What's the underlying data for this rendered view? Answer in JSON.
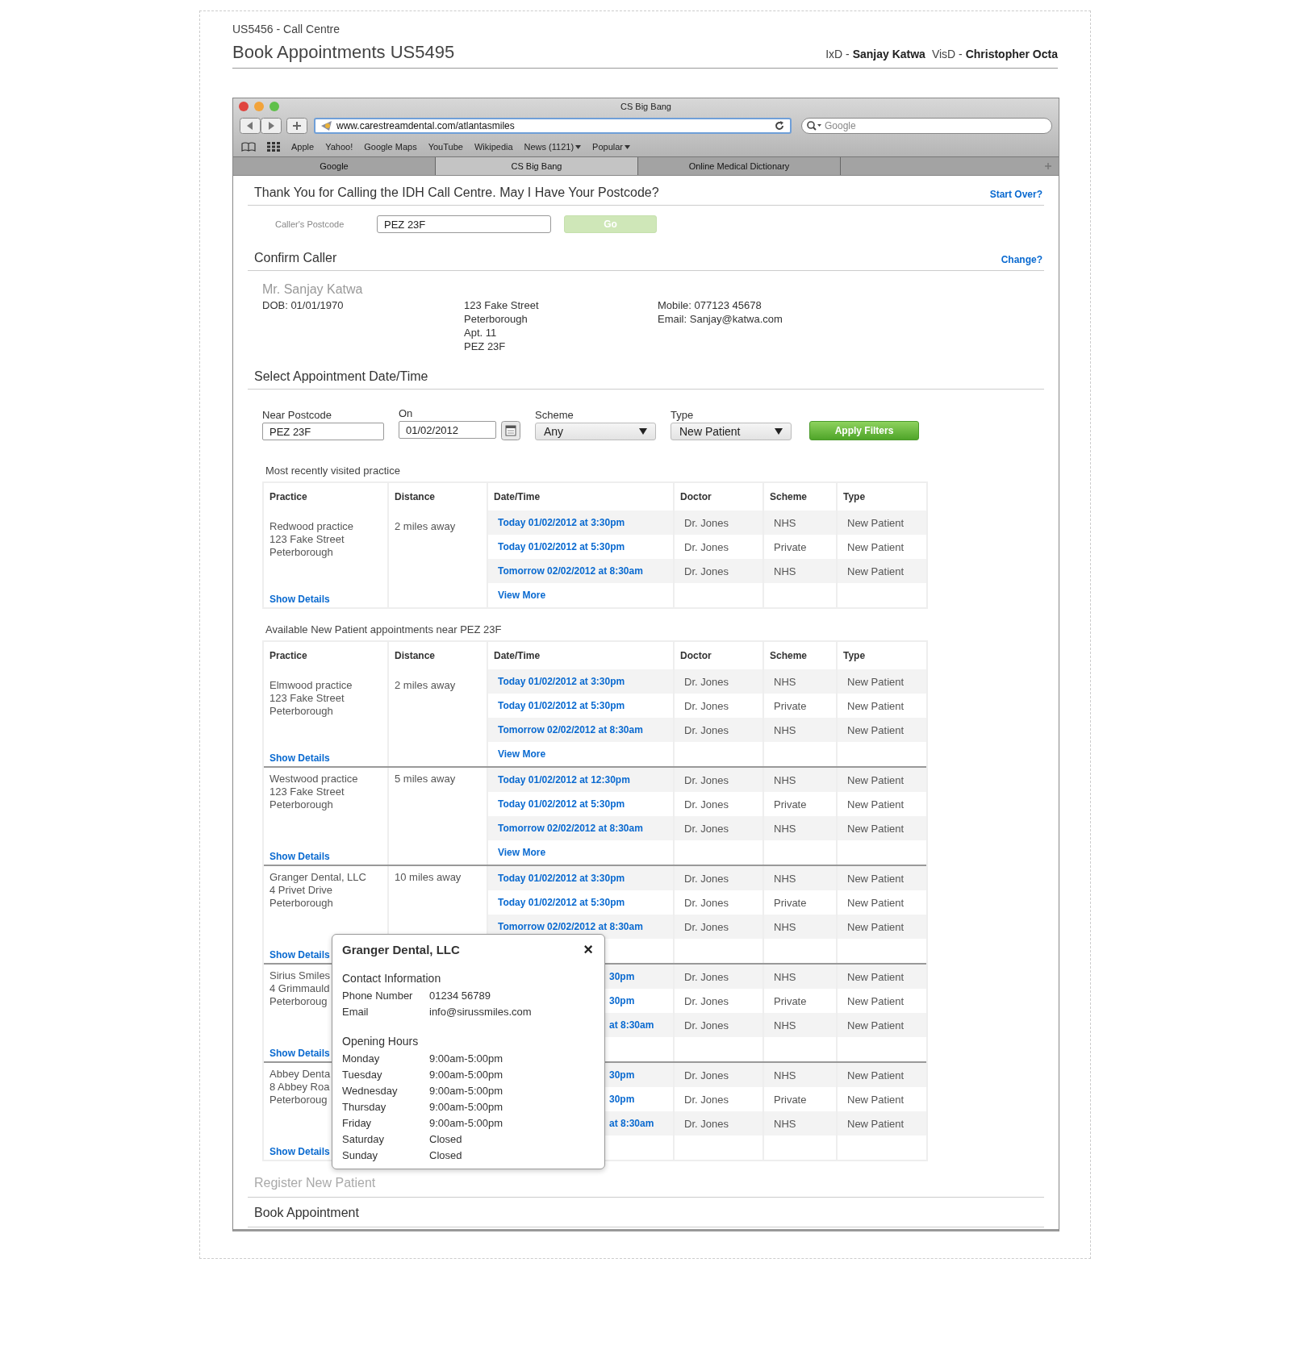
{
  "header": {
    "project": "US5456 - Call Centre",
    "title": "Book Appointments US5495",
    "credits": [
      "IxD - **Sanjay Katwa**",
      "VisD - **Christopher Octa**"
    ]
  },
  "browser": {
    "title": "CS Big Bang",
    "url": "www.carestreamdental.com/atlantasmiles",
    "search": {
      "placeholder": "Google"
    },
    "bookmarks": [
      {
        "label": "Apple",
        "kind": "link"
      },
      {
        "label": "Yahoo!",
        "kind": "link"
      },
      {
        "label": "Google Maps",
        "kind": "link"
      },
      {
        "label": "YouTube",
        "kind": "link"
      },
      {
        "label": "Wikipedia",
        "kind": "link"
      },
      {
        "label": "News (1121)",
        "kind": "menu"
      },
      {
        "label": "Popular",
        "kind": "menu"
      }
    ],
    "tabs": [
      {
        "label": "Google",
        "selected": false
      },
      {
        "label": "CS Big Bang",
        "selected": true
      },
      {
        "label": "Online Medical Dictionary",
        "selected": false
      }
    ]
  },
  "postcode": {
    "heading": "Thank You for Calling the IDH Call Centre. May I Have Your Postcode?",
    "link": "Start Over?",
    "label": "Caller's Postcode",
    "value": "PEZ 23F",
    "button": {
      "label": "Go",
      "disabled": true
    }
  },
  "caller": {
    "heading": "Confirm Caller",
    "link": "Change?",
    "name": "Mr. Sanjay Katwa",
    "dob": "DOB: 01/01/1970",
    "address": [
      "123 Fake Street",
      "Peterborough",
      "Apt. 11",
      "PEZ 23F"
    ],
    "contact": [
      "Mobile: 077123 45678",
      "Email: Sanjay@katwa.com"
    ]
  },
  "appointments": {
    "heading": "Select Appointment Date/Time",
    "filters": {
      "near": {
        "label": "Near Postcode",
        "value": "PEZ 23F"
      },
      "on": {
        "label": "On",
        "value": "01/02/2012"
      },
      "scheme": {
        "label": "Scheme",
        "value": "Any"
      },
      "type": {
        "label": "Type",
        "value": "New Patient"
      },
      "apply": "Apply Filters"
    },
    "tables": [
      {
        "caption": "Most recently visited practice",
        "columns": [
          "Practice",
          "Distance",
          "Date/Time",
          "Doctor",
          "Scheme",
          "Type"
        ],
        "groups": [
          {
            "practice": [
              "Redwood practice",
              "123 Fake Street",
              "Peterborough"
            ],
            "distance": "2 miles away",
            "show_details": "Show Details",
            "view_more": "View More",
            "covered": false,
            "slots": [
              {
                "datetime": "Today 01/02/2012 at 3:30pm",
                "doctor": "Dr. Jones",
                "scheme": "NHS",
                "type": "New Patient"
              },
              {
                "datetime": "Today 01/02/2012 at 5:30pm",
                "doctor": "Dr. Jones",
                "scheme": "Private",
                "type": "New Patient"
              },
              {
                "datetime": "Tomorrow 02/02/2012 at 8:30am",
                "doctor": "Dr. Jones",
                "scheme": "NHS",
                "type": "New Patient"
              }
            ]
          }
        ]
      },
      {
        "caption": "Available New Patient appointments near PEZ 23F",
        "columns": [
          "Practice",
          "Distance",
          "Date/Time",
          "Doctor",
          "Scheme",
          "Type"
        ],
        "groups": [
          {
            "practice": [
              "Elmwood practice",
              "123 Fake Street",
              "Peterborough"
            ],
            "distance": "2 miles away",
            "show_details": "Show Details",
            "view_more": "View More",
            "covered": false,
            "slots": [
              {
                "datetime": "Today 01/02/2012 at 3:30pm",
                "doctor": "Dr. Jones",
                "scheme": "NHS",
                "type": "New Patient"
              },
              {
                "datetime": "Today 01/02/2012 at 5:30pm",
                "doctor": "Dr. Jones",
                "scheme": "Private",
                "type": "New Patient"
              },
              {
                "datetime": "Tomorrow 02/02/2012 at 8:30am",
                "doctor": "Dr. Jones",
                "scheme": "NHS",
                "type": "New Patient"
              }
            ]
          },
          {
            "practice": [
              "Westwood practice",
              "123 Fake Street",
              "Peterborough"
            ],
            "distance": "5 miles away",
            "show_details": "Show Details",
            "view_more": "View More",
            "covered": false,
            "slots": [
              {
                "datetime": "Today 01/02/2012 at 12:30pm",
                "doctor": "Dr. Jones",
                "scheme": "NHS",
                "type": "New Patient"
              },
              {
                "datetime": "Today 01/02/2012 at 5:30pm",
                "doctor": "Dr. Jones",
                "scheme": "Private",
                "type": "New Patient"
              },
              {
                "datetime": "Tomorrow 02/02/2012 at 8:30am",
                "doctor": "Dr. Jones",
                "scheme": "NHS",
                "type": "New Patient"
              }
            ]
          },
          {
            "practice": [
              "Granger Dental, LLC",
              "4 Privet Drive",
              "Peterborough"
            ],
            "distance": "10 miles away",
            "show_details": "Show Details",
            "covered": false,
            "slots": [
              {
                "datetime": "Today 01/02/2012 at 3:30pm",
                "doctor": "Dr. Jones",
                "scheme": "NHS",
                "type": "New Patient"
              },
              {
                "datetime": "Today 01/02/2012 at 5:30pm",
                "doctor": "Dr. Jones",
                "scheme": "Private",
                "type": "New Patient"
              },
              {
                "datetime": "Tomorrow 02/02/2012 at 8:30am",
                "doctor": "Dr. Jones",
                "scheme": "NHS",
                "type": "New Patient"
              }
            ]
          },
          {
            "practice": [
              "Sirius Smiles",
              "4 Grimmauld",
              "Peterboroug"
            ],
            "show_details": "Show Details",
            "covered": true,
            "slots": [
              {
                "datetime": "30pm",
                "doctor": "Dr. Jones",
                "scheme": "NHS",
                "type": "New Patient"
              },
              {
                "datetime": "30pm",
                "doctor": "Dr. Jones",
                "scheme": "Private",
                "type": "New Patient"
              },
              {
                "datetime": "at 8:30am",
                "doctor": "Dr. Jones",
                "scheme": "NHS",
                "type": "New Patient"
              }
            ]
          },
          {
            "practice": [
              "Abbey Denta",
              "8 Abbey Roa",
              "Peterboroug"
            ],
            "show_details": "Show Details",
            "covered": true,
            "slots": [
              {
                "datetime": "30pm",
                "doctor": "Dr. Jones",
                "scheme": "NHS",
                "type": "New Patient"
              },
              {
                "datetime": "30pm",
                "doctor": "Dr. Jones",
                "scheme": "Private",
                "type": "New Patient"
              },
              {
                "datetime": "at 8:30am",
                "doctor": "Dr. Jones",
                "scheme": "NHS",
                "type": "New Patient"
              }
            ]
          }
        ]
      }
    ],
    "popup": {
      "title": "Granger Dental, LLC",
      "close": "×",
      "sections": [
        {
          "heading": "Contact Information",
          "rows": [
            {
              "label": "Phone Number",
              "value": "01234 56789"
            },
            {
              "label": "Email",
              "value": "info@sirussmiles.com"
            }
          ]
        },
        {
          "heading": "Opening Hours",
          "rows": [
            {
              "label": "Monday",
              "value": "9:00am-5:00pm"
            },
            {
              "label": "Tuesday",
              "value": "9:00am-5:00pm"
            },
            {
              "label": "Wednesday",
              "value": "9:00am-5:00pm"
            },
            {
              "label": "Thursday",
              "value": "9:00am-5:00pm"
            },
            {
              "label": "Friday",
              "value": "9:00am-5:00pm"
            },
            {
              "label": "Saturday",
              "value": "Closed"
            },
            {
              "label": "Sunday",
              "value": "Closed"
            }
          ]
        }
      ]
    }
  },
  "steps": [
    {
      "label": "Register New Patient",
      "disabled": true
    },
    {
      "label": "Book Appointment",
      "disabled": false
    }
  ]
}
